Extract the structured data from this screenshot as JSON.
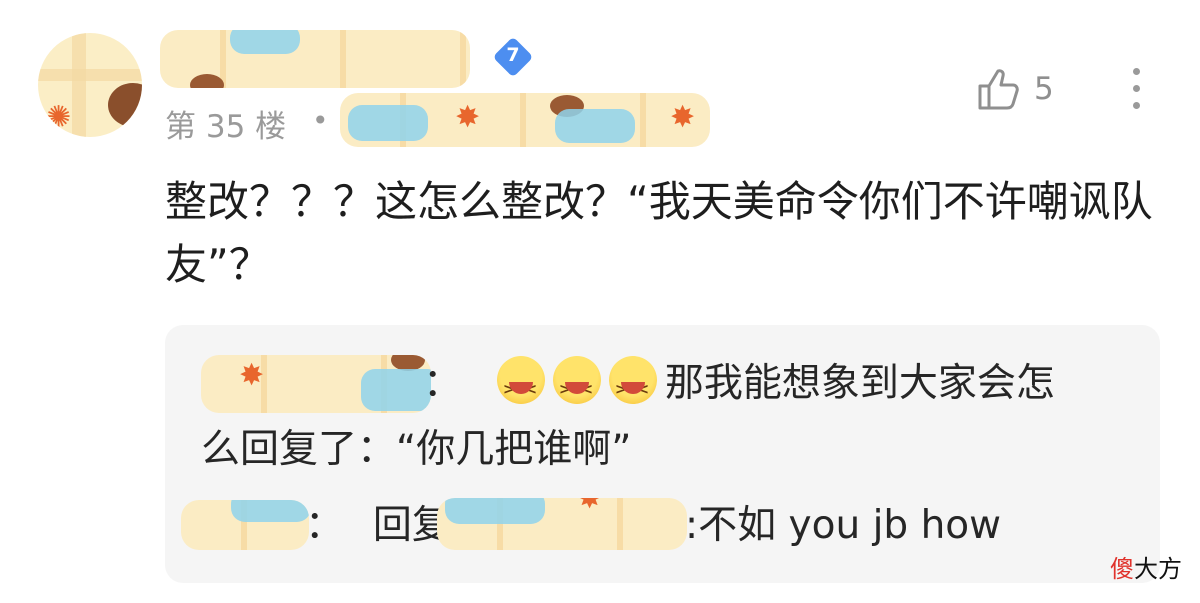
{
  "header": {
    "level_badge": "7",
    "floor_label": "第 35 楼",
    "separator": "•"
  },
  "like": {
    "count": "5",
    "icon": "thumbs-up-icon"
  },
  "more_icon": "more-vertical-icon",
  "comment": {
    "text": "整改？？？这怎么整改？“我天美命令你们不许嘲讽队友”？"
  },
  "replies": [
    {
      "colon": "：",
      "emoji_count": 3,
      "text_line1": "那我能想象到大家会怎",
      "text_line2": "么回复了：“你几把谁啊”"
    },
    {
      "colon": "：",
      "reply_word": "回复",
      "text": ":不如 you jb how"
    }
  ],
  "watermark": {
    "highlight": "傻",
    "rest": "大方"
  },
  "colors": {
    "floor_text": "#9a9a9a",
    "badge": "#4d8ef0",
    "reply_bg": "#f5f5f5"
  }
}
